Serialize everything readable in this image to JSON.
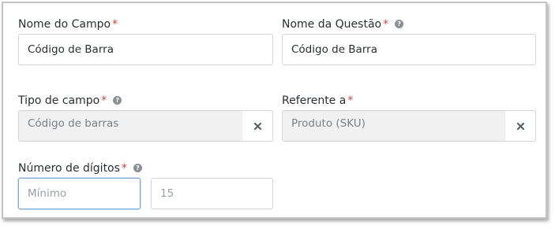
{
  "fields": {
    "nome_campo": {
      "label": "Nome do Campo",
      "required": "*",
      "value": "Código de Barra"
    },
    "nome_questao": {
      "label": "Nome da Questão",
      "required": "*",
      "value": "Código de Barra"
    },
    "tipo_campo": {
      "label": "Tipo de campo",
      "required": "*",
      "value": "Código de barras"
    },
    "referente": {
      "label": "Referente a",
      "required": "*",
      "value": "Produto (SKU)"
    },
    "numero_digitos": {
      "label": "Número de dígitos",
      "required": "*",
      "min_placeholder": "Mínimo",
      "max_value": "15"
    }
  },
  "icons": {
    "help": "question-circle-icon",
    "clear": "times-icon"
  },
  "colors": {
    "required": "#d0473c",
    "focus_border": "#79a9d9",
    "disabled_bg": "#f1f1f1"
  }
}
